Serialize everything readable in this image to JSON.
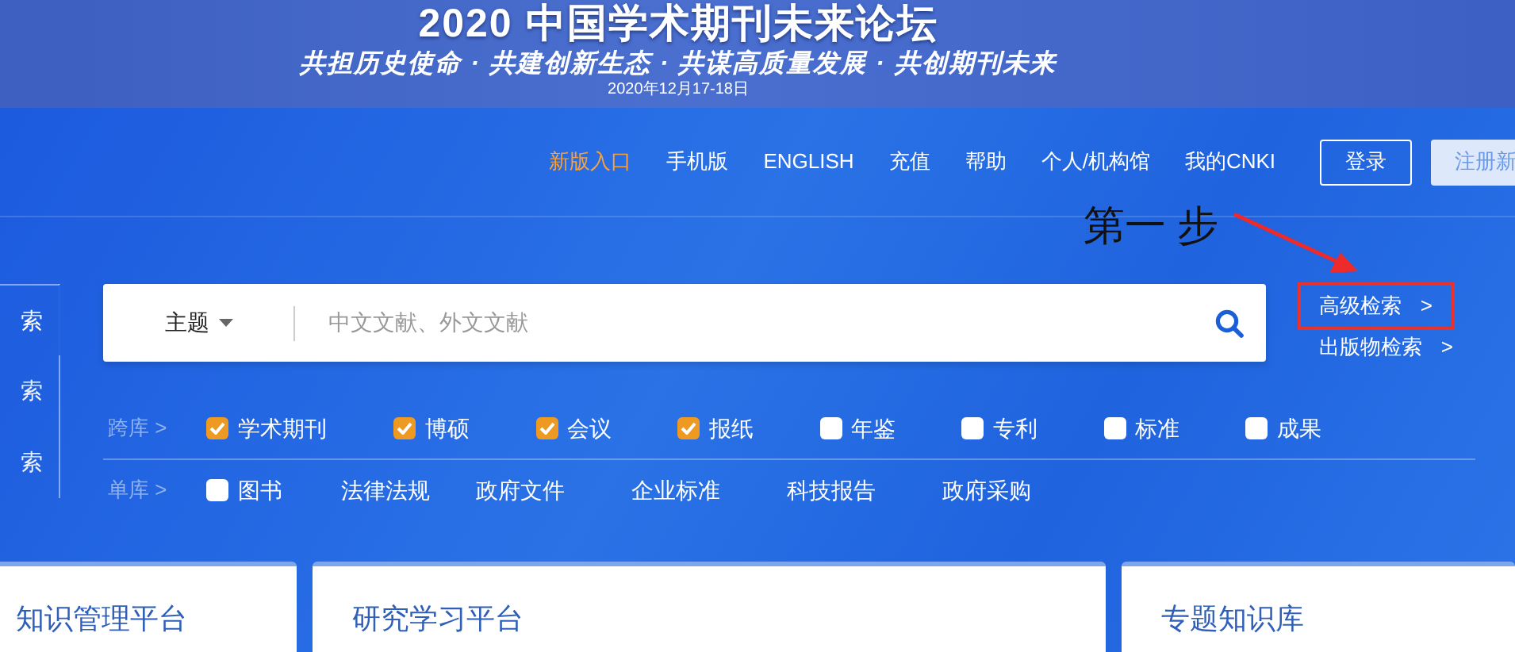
{
  "banner": {
    "title": "2020 中国学术期刊未来论坛",
    "slogan": "共担历史使命 · 共建创新生态 · 共谋高质量发展 · 共创期刊未来",
    "date": "2020年12月17-18日"
  },
  "nav": [
    {
      "label": "新版入口",
      "highlighted": true
    },
    {
      "label": "手机版",
      "highlighted": false
    },
    {
      "label": "ENGLISH",
      "highlighted": false
    },
    {
      "label": "充值",
      "highlighted": false
    },
    {
      "label": "帮助",
      "highlighted": false
    },
    {
      "label": "个人/机构馆",
      "highlighted": false
    },
    {
      "label": "我的CNKI",
      "highlighted": false
    }
  ],
  "account_buttons": [
    {
      "label": "登录",
      "kind": "outline"
    },
    {
      "label": "注册新",
      "kind": "light"
    }
  ],
  "annotation": {
    "text": "第一 步"
  },
  "sidebar_tabs": [
    {
      "label": "索",
      "selected": true
    },
    {
      "label": "索",
      "selected": false
    },
    {
      "label": "索",
      "selected": false
    }
  ],
  "search": {
    "field": "主题",
    "placeholder": "中文文献、外文文献"
  },
  "side_links": [
    {
      "label": "高级检索",
      "arrow": ">",
      "annotated": true
    },
    {
      "label": "出版物检索",
      "arrow": ">",
      "annotated": false
    }
  ],
  "database_rows": [
    {
      "label": "跨库",
      "arrow": ">",
      "items": [
        {
          "label": "学术期刊",
          "kind": "checkbox",
          "checked": true
        },
        {
          "label": "博硕",
          "kind": "checkbox",
          "checked": true
        },
        {
          "label": "会议",
          "kind": "checkbox",
          "checked": true
        },
        {
          "label": "报纸",
          "kind": "checkbox",
          "checked": true
        },
        {
          "label": "年鉴",
          "kind": "checkbox",
          "checked": false
        },
        {
          "label": "专利",
          "kind": "checkbox",
          "checked": false
        },
        {
          "label": "标准",
          "kind": "checkbox",
          "checked": false
        },
        {
          "label": "成果",
          "kind": "checkbox",
          "checked": false
        }
      ]
    },
    {
      "label": "单库",
      "arrow": ">",
      "items": [
        {
          "label": "图书",
          "kind": "checkbox",
          "checked": false
        },
        {
          "label": "法律法规",
          "kind": "link"
        },
        {
          "label": "政府文件",
          "kind": "link"
        },
        {
          "label": "企业标准",
          "kind": "link"
        },
        {
          "label": "科技报告",
          "kind": "link"
        },
        {
          "label": "政府采购",
          "kind": "link"
        }
      ]
    }
  ],
  "cards": [
    {
      "title": "知识管理平台"
    },
    {
      "title": "研究学习平台"
    },
    {
      "title": "专题知识库"
    }
  ]
}
